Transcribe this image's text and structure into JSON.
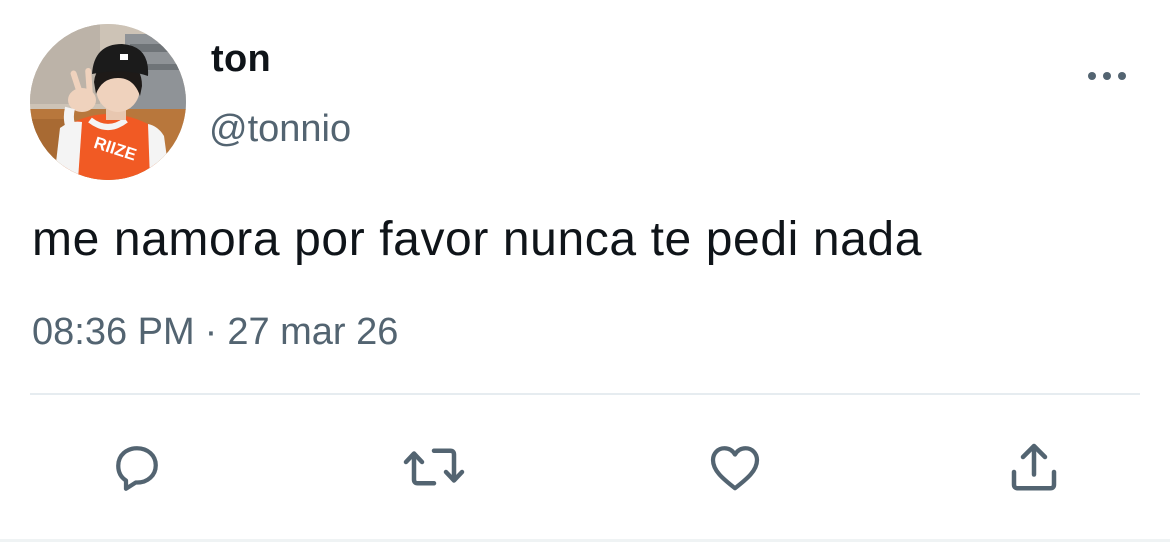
{
  "author": {
    "display_name": "ton",
    "handle": "@tonnio",
    "avatar_jersey_text": "RIIZE"
  },
  "tweet": {
    "text": "me namora por favor nunca te pedi nada",
    "time": "08:36 PM",
    "separator": "·",
    "date": "27 mar 26"
  },
  "actions": {
    "more_icon": "more-horizontal-icon",
    "reply_icon": "reply-bubble-icon",
    "retweet_icon": "retweet-icon",
    "like_icon": "heart-icon",
    "share_icon": "share-upload-icon"
  },
  "colors": {
    "text_primary": "#0f1419",
    "text_secondary": "#536471",
    "divider": "#e6ecf0",
    "icon": "#536471"
  }
}
